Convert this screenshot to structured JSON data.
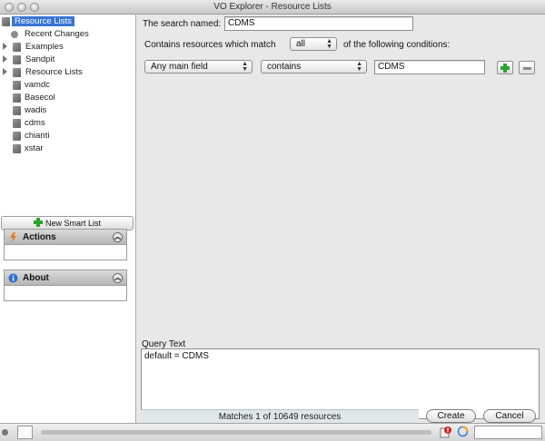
{
  "window": {
    "title": "VO Explorer - Resource Lists"
  },
  "sidebar": {
    "tree": [
      {
        "label": "Resource Lists",
        "kind": "doc",
        "selected": true
      },
      {
        "label": "Recent Changes",
        "kind": "dot"
      },
      {
        "label": "Examples",
        "kind": "folder",
        "expandable": true
      },
      {
        "label": "Sandpit",
        "kind": "folder",
        "expandable": true
      },
      {
        "label": "Resource Lists",
        "kind": "folder",
        "expandable": true
      },
      {
        "label": "vamdc",
        "kind": "doc"
      },
      {
        "label": "Basecol",
        "kind": "doc"
      },
      {
        "label": "wadis",
        "kind": "doc"
      },
      {
        "label": "cdms",
        "kind": "doc"
      },
      {
        "label": "chianti",
        "kind": "doc"
      },
      {
        "label": "xstar",
        "kind": "doc"
      }
    ],
    "new_smart_list": "New Smart List",
    "panels": {
      "actions": {
        "title": "Actions",
        "icon": "lightning-icon"
      },
      "about": {
        "title": "About",
        "icon": "info-icon"
      }
    }
  },
  "search": {
    "named_label": "The search named:",
    "name_value": "CDMS",
    "contains_prefix": "Contains resources which match",
    "match_mode": "all",
    "contains_suffix": "of the following conditions:",
    "condition": {
      "field": "Any main field",
      "operator": "contains",
      "value": "CDMS"
    }
  },
  "query": {
    "label": "Query Text",
    "text": "default = CDMS"
  },
  "footer": {
    "matches": "Matches 1 of 10649 resources",
    "create": "Create",
    "cancel": "Cancel"
  },
  "colors": {
    "selection": "#3875d7",
    "add_green": "#2aa52a",
    "actions_orange": "#e8731a",
    "about_blue": "#2a6fd6"
  }
}
